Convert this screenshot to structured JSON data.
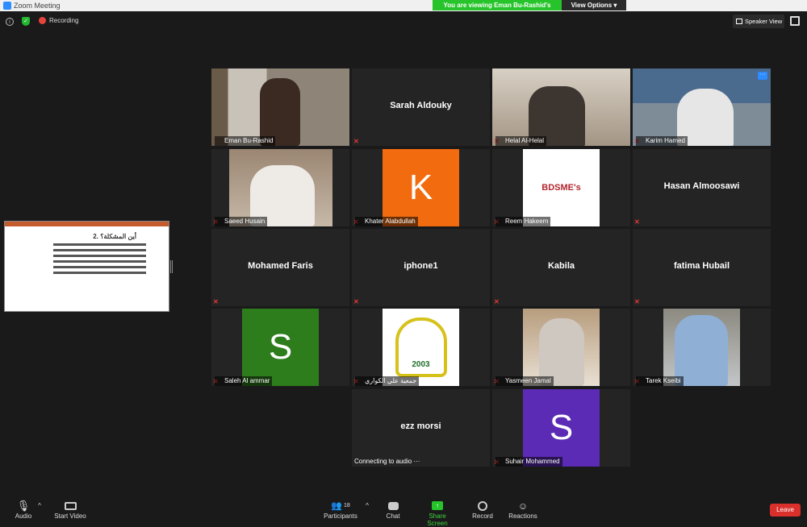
{
  "window": {
    "title": "Zoom Meeting"
  },
  "share_banner": {
    "message": "You are viewing Eman Bu-Rashid's screen",
    "options_label": "View Options"
  },
  "topbar": {
    "recording_label": "Recording",
    "speaker_view_label": "Speaker View"
  },
  "shared_screen": {
    "heading": "2. أين المشكلة؟"
  },
  "participants": [
    {
      "name": "Eman Bu-Rashid",
      "display": "",
      "type": "video"
    },
    {
      "name": "",
      "display": "Sarah Aldouky",
      "type": "name"
    },
    {
      "name": "Helal Al-Helal",
      "display": "",
      "type": "video"
    },
    {
      "name": "Karim Hamed",
      "display": "",
      "type": "video"
    },
    {
      "name": "Saeed Husain",
      "display": "",
      "type": "video"
    },
    {
      "name": "Khater Alabdullah",
      "display": "K",
      "type": "avatar"
    },
    {
      "name": "Reem Hakeem",
      "display": "BDSME's",
      "type": "logo"
    },
    {
      "name": "",
      "display": "Hasan Almoosawi",
      "type": "name"
    },
    {
      "name": "",
      "display": "Mohamed Faris",
      "type": "name"
    },
    {
      "name": "",
      "display": "iphone1",
      "type": "name"
    },
    {
      "name": "",
      "display": "Kabila",
      "type": "name"
    },
    {
      "name": "",
      "display": "fatima Hubail",
      "type": "name"
    },
    {
      "name": "Saleh Al ammar",
      "display": "S",
      "type": "avatar"
    },
    {
      "name": "جمعية علي الكواري",
      "display": "2003",
      "type": "logo"
    },
    {
      "name": "Yasmeen Jamal",
      "display": "",
      "type": "video"
    },
    {
      "name": "Tarek Kseibi",
      "display": "",
      "type": "video"
    },
    {
      "name": "Connecting to audio ···",
      "display": "ezz morsi",
      "type": "name"
    },
    {
      "name": "Suhair Mohammed",
      "display": "S",
      "type": "avatar"
    }
  ],
  "toolbar": {
    "audio": "Audio",
    "start_video": "Start Video",
    "participants": "Participants",
    "participant_count": "18",
    "chat": "Chat",
    "share_screen": "Share Screen",
    "record": "Record",
    "reactions": "Reactions",
    "leave": "Leave"
  },
  "colors": {
    "accent_green": "#26c42a",
    "active_speaker": "#b9d600",
    "k_avatar": "#f26b0f",
    "s_avatar": "#2e7d1c",
    "s_avatar2": "#5b2bb5",
    "leave": "#d9302c"
  }
}
